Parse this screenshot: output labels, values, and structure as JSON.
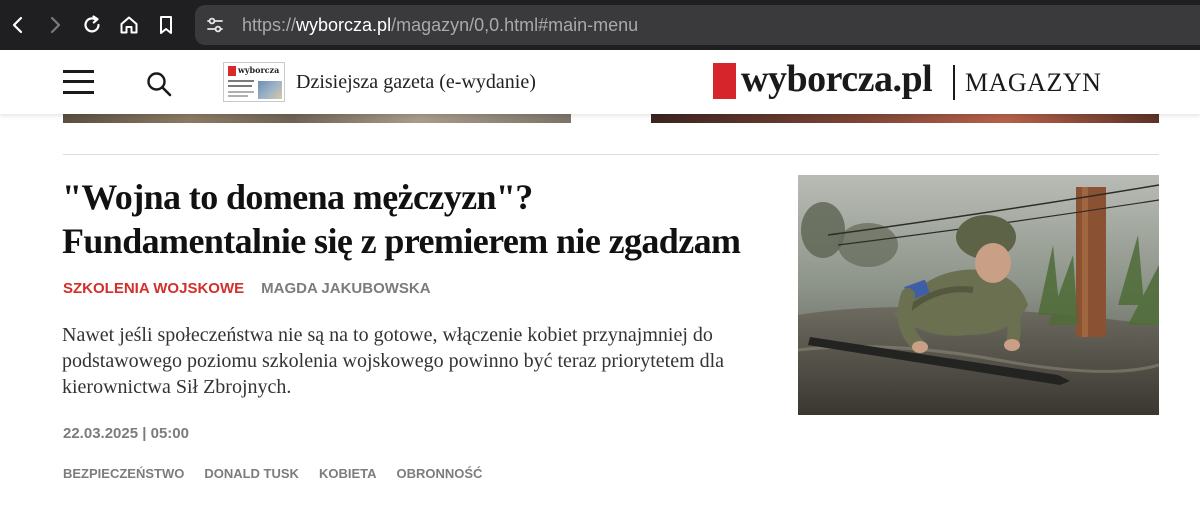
{
  "browser": {
    "url_prefix": "https://",
    "url_domain": "wyborcza.pl",
    "url_path": "/magazyn/0,0.html#main-menu",
    "icons": [
      "back-icon",
      "forward-icon",
      "reload-icon",
      "home-icon",
      "bookmark-icon",
      "site-settings-icon"
    ]
  },
  "header": {
    "epaper_label": "Dzisiejsza gazeta (e-wydanie)",
    "epaper_thumb_mast": "wyborcza",
    "logo_text": "wyborcza.pl",
    "section_name": "MAGAZYN",
    "icons": [
      "menu-icon",
      "search-icon"
    ],
    "colors": {
      "brand_red": "#d7262b"
    }
  },
  "article": {
    "headline": "\"Wojna to domena mężczyzn\"? Fundamentalnie się z premierem nie zgadzam",
    "category": "SZKOLENIA WOJSKOWE",
    "author": "MAGDA JAKUBOWSKA",
    "lead": "Nawet jeśli społeczeństwa nie są na to gotowe, włączenie kobiet przynajmniej do podstawowego poziomu szkolenia wojskowego powinno być teraz priorytetem dla kierownictwa Sił Zbrojnych.",
    "date": "22.03.2025 | 05:00",
    "tags": [
      "BEZPIECZEŃSTWO",
      "DONALD TUSK",
      "KOBIETA",
      "OBRONNOŚĆ"
    ],
    "colors": {
      "category": "#d22f2b",
      "meta_gray": "#7c7c7c"
    }
  }
}
